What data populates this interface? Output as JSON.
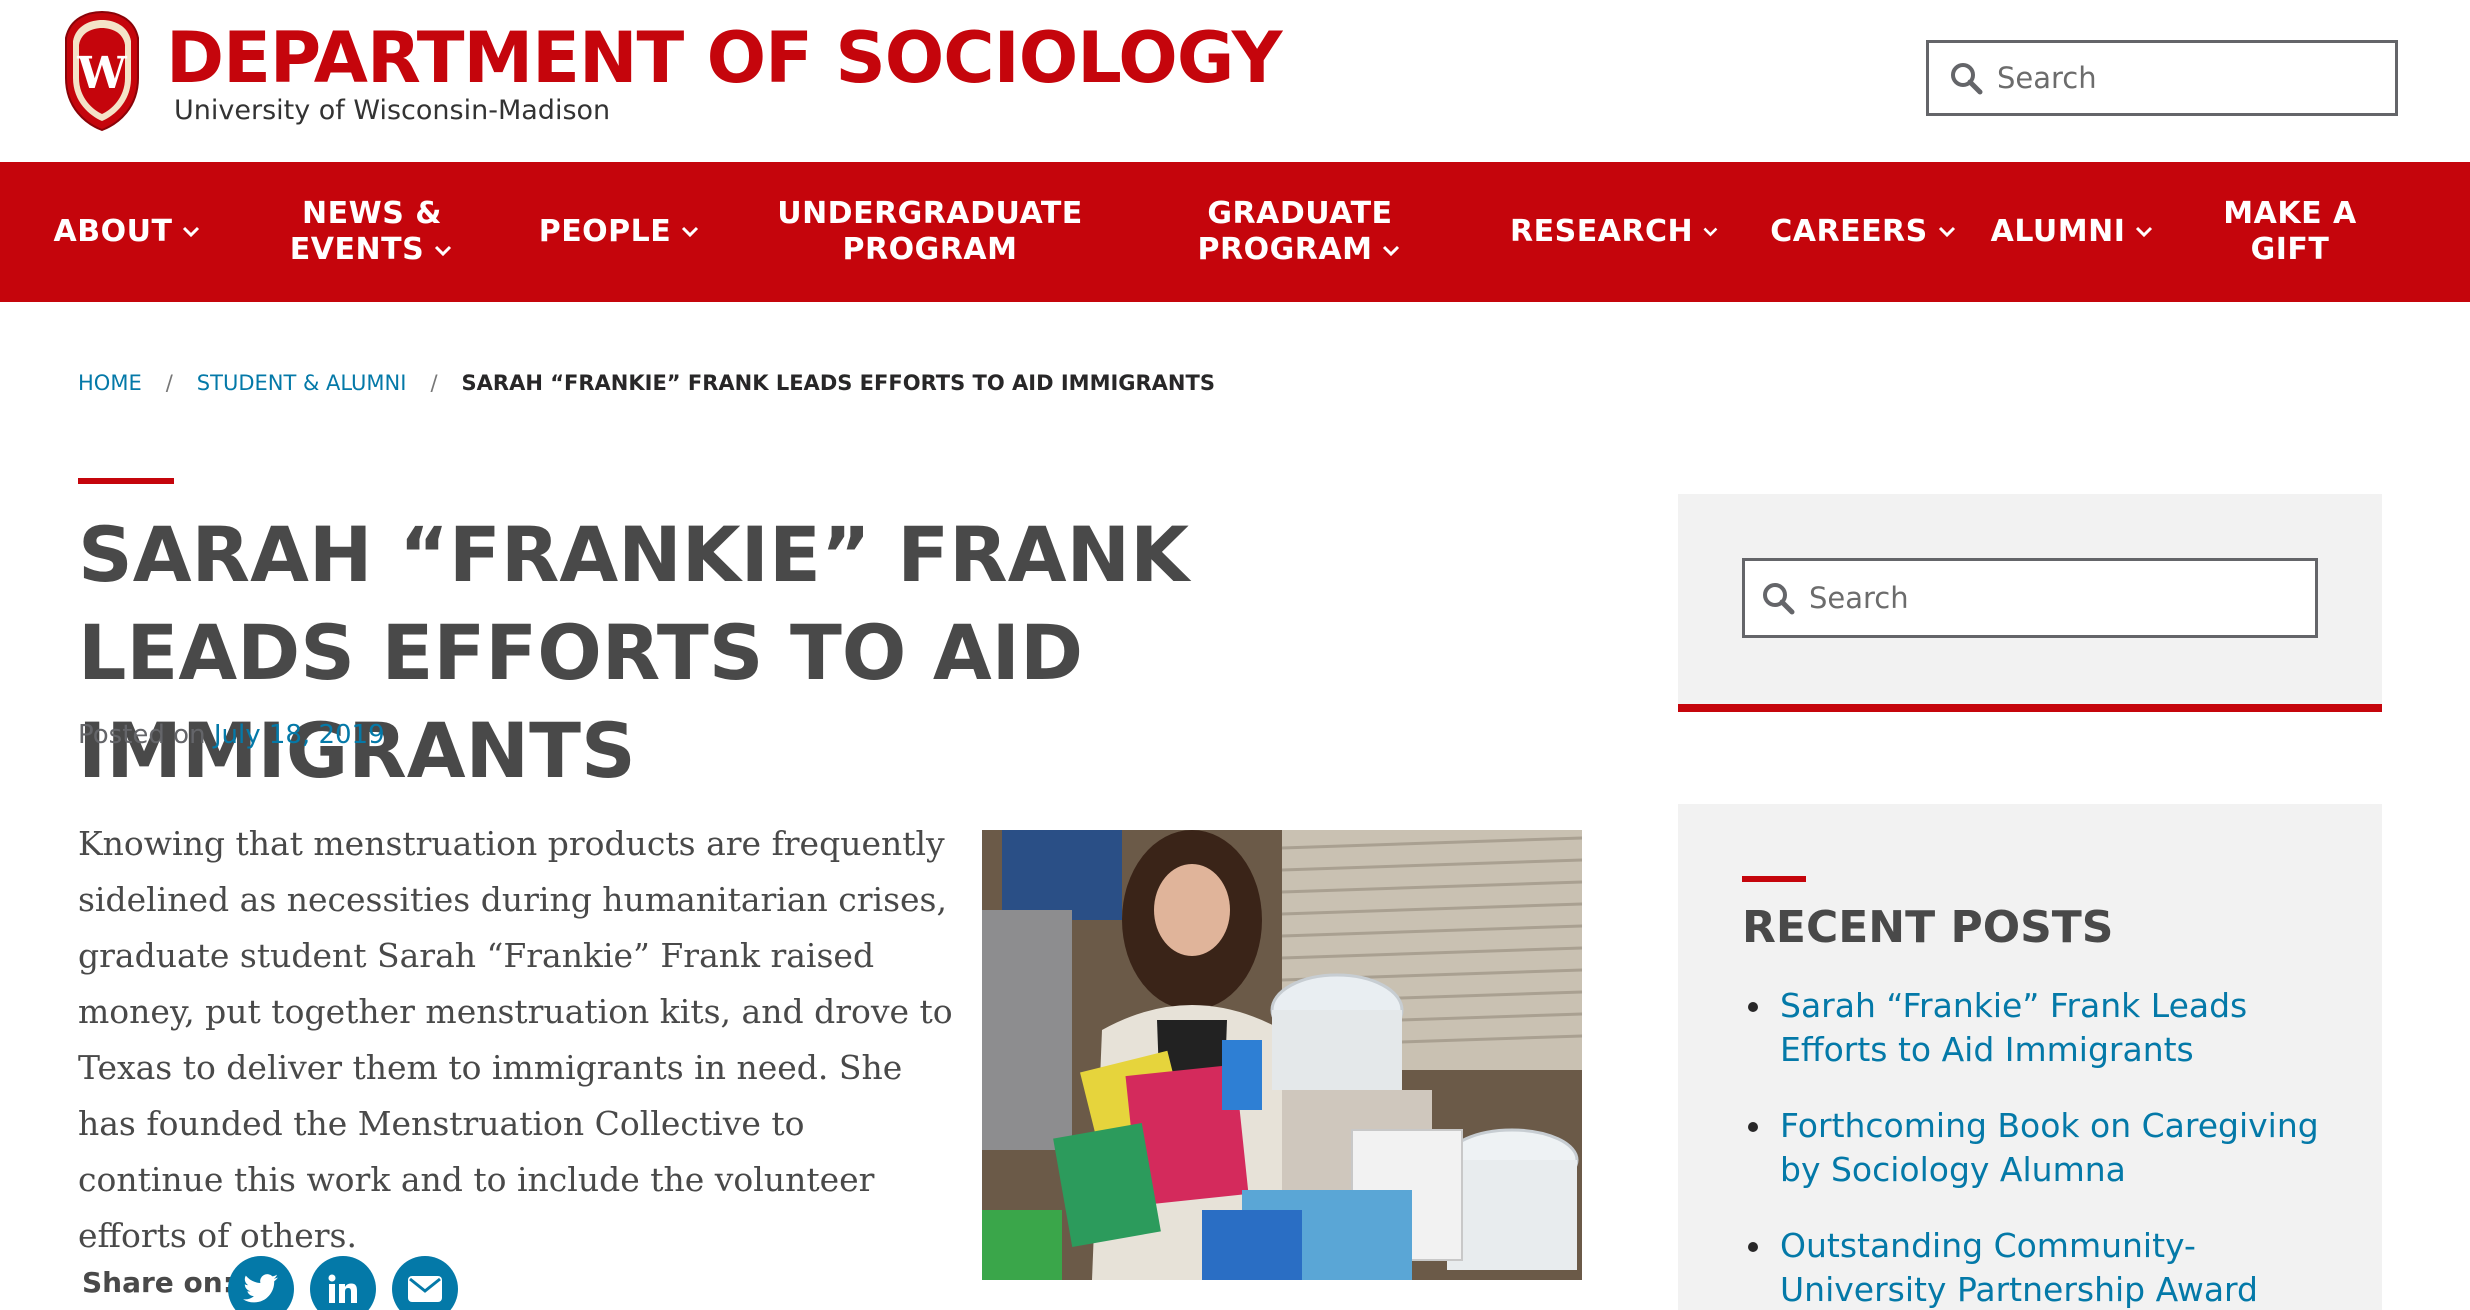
{
  "header": {
    "title": "DEPARTMENT OF SOCIOLOGY",
    "subtitle": "University of Wisconsin-Madison",
    "search_placeholder": "Search",
    "crest_letter": "W"
  },
  "nav": {
    "items": [
      {
        "label": "ABOUT",
        "line2": "",
        "dropdown": true
      },
      {
        "label": "NEWS &",
        "line2": "EVENTS",
        "dropdown": true
      },
      {
        "label": "PEOPLE",
        "line2": "",
        "dropdown": true
      },
      {
        "label": "UNDERGRADUATE",
        "line2": "PROGRAM",
        "dropdown": false
      },
      {
        "label": "GRADUATE",
        "line2": "PROGRAM",
        "dropdown": true
      },
      {
        "label": "RESEARCH",
        "line2": "",
        "dropdown": true
      },
      {
        "label": "CAREERS",
        "line2": "",
        "dropdown": true
      },
      {
        "label": "ALUMNI",
        "line2": "",
        "dropdown": true
      },
      {
        "label": "MAKE A",
        "line2": "GIFT",
        "dropdown": false
      }
    ]
  },
  "breadcrumb": {
    "home": "Home",
    "section": "Student & Alumni",
    "current": "Sarah “Frankie” Frank Leads Efforts to Aid Immigrants",
    "separator": "/"
  },
  "article": {
    "title": "SARAH “FRANKIE” FRANK LEADS EFFORTS TO AID IMMIGRANTS",
    "posted_prefix": "Posted on",
    "posted_date": "July 18, 2019",
    "body": "Knowing that menstruation products are frequently sidelined as necessities during humanitarian crises, graduate student Sarah “Frankie” Frank raised money, put together menstruation kits, and drove to Texas to deliver them to immigrants in need.  She has founded the Menstruation Collective to continue this work and to include the volunteer efforts of others.",
    "share_label": "Share on:"
  },
  "sidebar": {
    "search_placeholder": "Search",
    "recent_title": "RECENT POSTS",
    "recent_posts": [
      "Sarah “Frankie” Frank Leads Efforts to Aid Immigrants",
      "Forthcoming Book on Caregiving by Sociology Alumna",
      "Outstanding Community-University Partnership Award"
    ]
  },
  "colors": {
    "brand_red": "#c5050c",
    "link_blue": "#0479a8",
    "heading_gray": "#494949",
    "sidebar_bg": "#f2f2f2"
  },
  "icons": [
    "uw-crest-icon",
    "search-icon",
    "chevron-down-icon",
    "twitter-icon",
    "linkedin-icon",
    "email-icon"
  ]
}
